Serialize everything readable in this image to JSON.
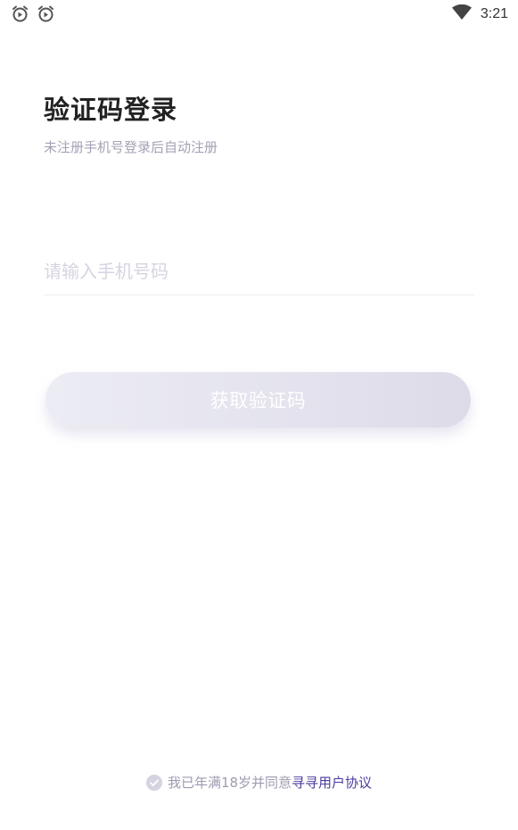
{
  "status_bar": {
    "left_icons": [
      "alarm-icon",
      "alarm-icon"
    ],
    "wifi_icon": "wifi-icon",
    "time": "3:21"
  },
  "login": {
    "title": "验证码登录",
    "subtitle": "未注册手机号登录后自动注册",
    "phone_placeholder": "请输入手机号码",
    "phone_value": "",
    "get_code_label": "获取验证码"
  },
  "agreement": {
    "checked": true,
    "text": "我已年满18岁并同意",
    "link_label": "寻寻用户协议"
  },
  "colors": {
    "title": "#222222",
    "subtitle": "#a4a1b6",
    "placeholder": "#d6d4e0",
    "button_bg": "#e4e3ee",
    "link": "#4a3d9e"
  }
}
